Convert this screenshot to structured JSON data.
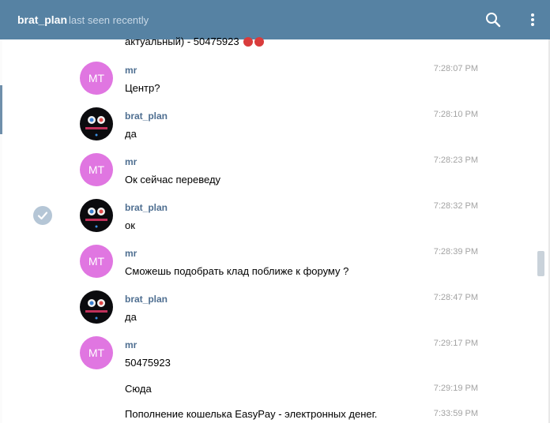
{
  "header": {
    "title": "brat_plan",
    "status": "last seen recently",
    "search_icon": "search-icon",
    "more_icon": "more-vertical-icon"
  },
  "top_partial_text": "актуальный) - 50475923",
  "messages": [
    {
      "avatar_type": "initials",
      "initials": "MT",
      "name": "mr",
      "text": "Центр?",
      "time": "7:28:07 PM"
    },
    {
      "avatar_type": "image",
      "name": "brat_plan",
      "text": "да",
      "time": "7:28:10 PM"
    },
    {
      "avatar_type": "initials",
      "initials": "MT",
      "name": "mr",
      "text": "Ок сейчас переведу",
      "time": "7:28:23 PM"
    },
    {
      "avatar_type": "image",
      "name": "brat_plan",
      "text": "ок",
      "time": "7:28:32 PM",
      "selected": true
    },
    {
      "avatar_type": "initials",
      "initials": "MT",
      "name": "mr",
      "text": "Сможешь подобрать клад поближе к форуму ?",
      "time": "7:28:39 PM"
    },
    {
      "avatar_type": "image",
      "name": "brat_plan",
      "text": "да",
      "time": "7:28:47 PM"
    },
    {
      "avatar_type": "initials",
      "initials": "MT",
      "name": "mr",
      "text": "50475923",
      "time": "7:29:17 PM"
    }
  ],
  "plain_messages": [
    {
      "text": "Сюда",
      "time": "7:29:19 PM"
    },
    {
      "text": "Пополнение кошелька EasyPay - электронных денег.",
      "time": "7:33:59 PM"
    }
  ],
  "colors": {
    "header_bg": "#5682a3",
    "name_color": "#4f6f91",
    "avatar_mt_bg": "#e076e1",
    "time_color": "#a3a3a3"
  }
}
